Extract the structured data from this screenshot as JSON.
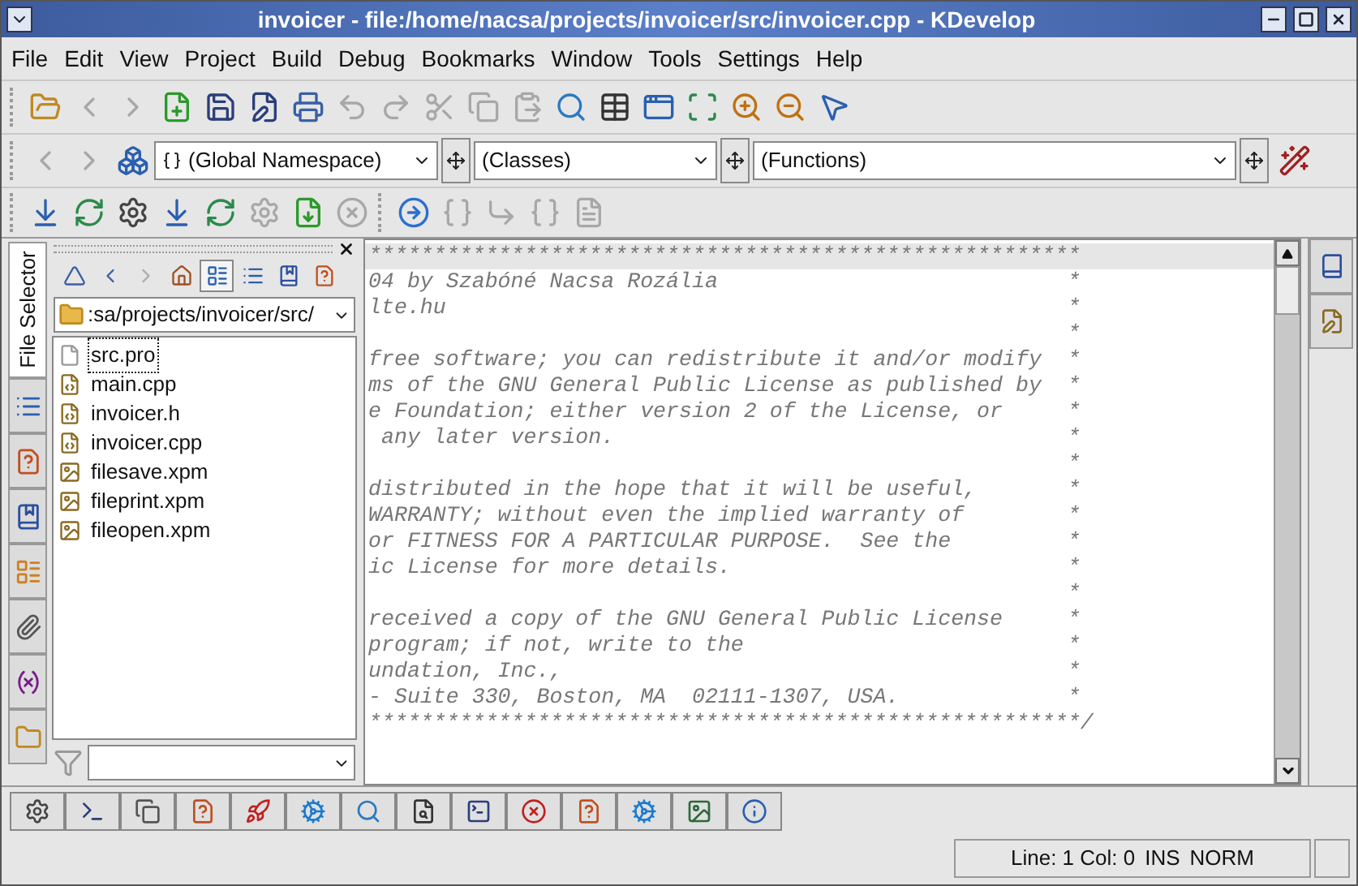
{
  "window": {
    "title": "invoicer - file:/home/nacsa/projects/invoicer/src/invoicer.cpp - KDevelop"
  },
  "menu": [
    "File",
    "Edit",
    "View",
    "Project",
    "Build",
    "Debug",
    "Bookmarks",
    "Window",
    "Tools",
    "Settings",
    "Help"
  ],
  "main_toolbar": [
    {
      "disabled": false
    },
    {
      "disabled": true
    },
    {
      "disabled": true
    },
    {
      "disabled": false
    },
    {
      "disabled": false
    },
    {
      "disabled": false
    },
    {
      "disabled": false
    },
    {
      "disabled": true
    },
    {
      "disabled": true
    },
    {
      "disabled": true
    },
    {
      "disabled": true
    },
    {
      "disabled": true
    },
    {
      "disabled": false
    },
    {
      "disabled": false
    },
    {
      "disabled": false
    },
    {
      "disabled": false
    },
    {
      "disabled": false
    },
    {
      "disabled": false
    },
    {
      "disabled": false
    }
  ],
  "browser_toolbar": {
    "namespace": "(Global Namespace)",
    "classes": "(Classes)",
    "functions": "(Functions)"
  },
  "build_toolbar": [
    {
      "disabled": false
    },
    {
      "disabled": false
    },
    {
      "disabled": false
    },
    {
      "disabled": false
    },
    {
      "disabled": false
    },
    {
      "disabled": true
    },
    {
      "disabled": false
    },
    {
      "disabled": true
    },
    {
      "disabled": false
    },
    {
      "disabled": true
    },
    {
      "disabled": true
    },
    {
      "disabled": true
    },
    {
      "disabled": true
    }
  ],
  "side_tabs": [
    {
      "kind": "text",
      "label": "File Selector",
      "selected": true
    },
    {
      "kind": "icon",
      "selected": false
    },
    {
      "kind": "icon",
      "selected": false
    },
    {
      "kind": "icon",
      "selected": false
    },
    {
      "kind": "icon",
      "selected": false
    },
    {
      "kind": "icon",
      "selected": false
    },
    {
      "kind": "icon",
      "selected": false
    },
    {
      "kind": "icon",
      "selected": false
    }
  ],
  "file_selector": {
    "path": ":sa/projects/invoicer/src/",
    "files": [
      {
        "name": "src.pro",
        "kind": "project",
        "selected": true
      },
      {
        "name": "main.cpp",
        "kind": "source",
        "selected": false
      },
      {
        "name": "invoicer.h",
        "kind": "source",
        "selected": false
      },
      {
        "name": "invoicer.cpp",
        "kind": "source",
        "selected": false
      },
      {
        "name": "filesave.xpm",
        "kind": "image",
        "selected": false
      },
      {
        "name": "fileprint.xpm",
        "kind": "image",
        "selected": false
      },
      {
        "name": "fileopen.xpm",
        "kind": "image",
        "selected": false
      }
    ]
  },
  "editor": {
    "lines": [
      {
        "text": "*******************************************************",
        "current": true
      },
      {
        "text": "04 by Szabóné Nacsa Rozália",
        "end": "*",
        "current": false
      },
      {
        "text": "lte.hu",
        "end": "*",
        "current": false
      },
      {
        "end": "*",
        "current": false
      },
      {
        "text": "free software; you can redistribute it and/or modify",
        "end": "*",
        "current": false
      },
      {
        "text": "ms of the GNU General Public License as published by",
        "end": "*",
        "current": false
      },
      {
        "text": "e Foundation; either version 2 of the License, or",
        "end": "*",
        "current": false
      },
      {
        "text": " any later version.",
        "end": "*",
        "current": false
      },
      {
        "end": "*",
        "current": false
      },
      {
        "text": "distributed in the hope that it will be useful,",
        "end": "*",
        "current": false
      },
      {
        "text": "WARRANTY; without even the implied warranty of",
        "end": "*",
        "current": false
      },
      {
        "text": "or FITNESS FOR A PARTICULAR PURPOSE.  See the",
        "end": "*",
        "current": false
      },
      {
        "text": "ic License for more details.",
        "end": "*",
        "current": false
      },
      {
        "end": "*",
        "current": false
      },
      {
        "text": "received a copy of the GNU General Public License",
        "end": "*",
        "current": false
      },
      {
        "text": "program; if not, write to the",
        "end": "*",
        "current": false
      },
      {
        "text": "undation, Inc.,",
        "end": "*",
        "current": false
      },
      {
        "text": "- Suite 330, Boston, MA  02111-1307, USA.",
        "end": "*",
        "current": false
      },
      {
        "text": "*******************************************************/",
        "current": false
      }
    ]
  },
  "status_bar": {
    "position": "Line: 1 Col: 0",
    "insert_mode": "INS",
    "edit_mode": "NORM"
  }
}
